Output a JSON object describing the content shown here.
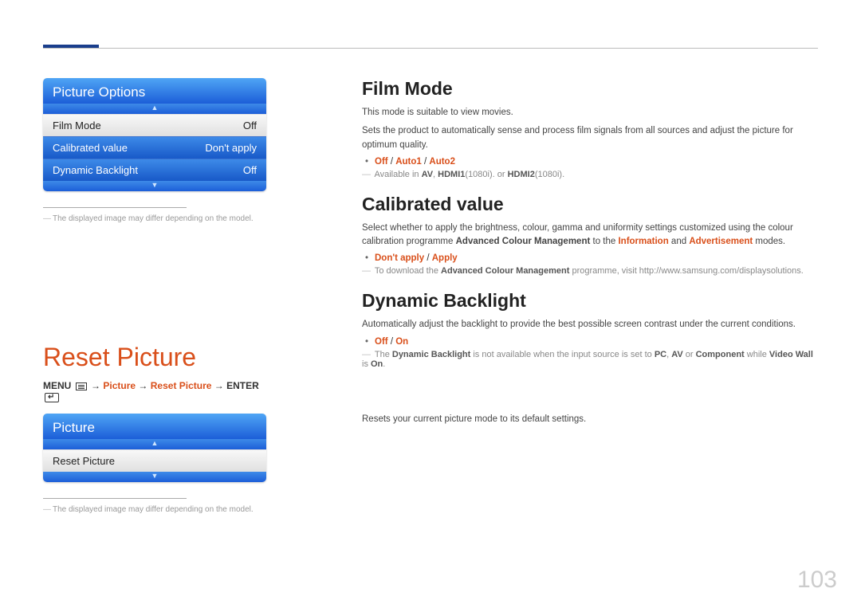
{
  "page_number": "103",
  "left": {
    "panel1": {
      "title": "Picture Options",
      "rows": [
        {
          "label": "Film Mode",
          "value": "Off",
          "selected": true
        },
        {
          "label": "Calibrated value",
          "value": "Don't apply",
          "selected": false
        },
        {
          "label": "Dynamic Backlight",
          "value": "Off",
          "selected": false
        }
      ],
      "footnote": "The displayed image may differ depending on the model."
    },
    "reset_title": "Reset Picture",
    "breadcrumb": {
      "menu": "MENU",
      "picture": "Picture",
      "reset": "Reset Picture",
      "enter": "ENTER",
      "arrow": "→"
    },
    "panel2": {
      "title": "Picture",
      "row": {
        "label": "Reset Picture"
      },
      "footnote": "The displayed image may differ depending on the model."
    }
  },
  "right": {
    "film_mode": {
      "heading": "Film Mode",
      "p1": "This mode is suitable to view movies.",
      "p2": "Sets the product to automatically sense and process film signals from all sources and adjust the picture for optimum quality.",
      "options": {
        "a": "Off",
        "b": "Auto1",
        "c": "Auto2"
      },
      "note_pre": "Available in ",
      "note_av": "AV",
      "note_mid1": ", ",
      "note_h1": "HDMI1",
      "note_res1": "(1080i). or ",
      "note_h2": "HDMI2",
      "note_res2": "(1080i)."
    },
    "calibrated": {
      "heading": "Calibrated value",
      "p1a": "Select whether to apply the brightness, colour, gamma and uniformity settings customized using the colour calibration programme ",
      "p1b": "Advanced Colour Management",
      "p1c": " to the ",
      "p1d": "Information",
      "p1e": " and ",
      "p1f": "Advertisement",
      "p1g": " modes.",
      "options": {
        "a": "Don't apply",
        "b": "Apply"
      },
      "note_pre": "To download the ",
      "note_prog": "Advanced Colour Management",
      "note_post": " programme, visit http://www.samsung.com/displaysolutions."
    },
    "dynamic": {
      "heading": "Dynamic Backlight",
      "p1": "Automatically adjust the backlight to provide the best possible screen contrast under the current conditions.",
      "options": {
        "a": "Off",
        "b": "On"
      },
      "note_pre": "The ",
      "note_db": "Dynamic Backlight",
      "note_mid": " is not available when the input source is set to ",
      "note_pc": "PC",
      "note_c1": ", ",
      "note_av": "AV",
      "note_c2": " or ",
      "note_comp": "Component",
      "note_while": " while ",
      "note_vw": "Video Wall",
      "note_is": " is ",
      "note_on": "On",
      "note_dot": "."
    },
    "reset_para": "Resets your current picture mode to its default settings."
  }
}
